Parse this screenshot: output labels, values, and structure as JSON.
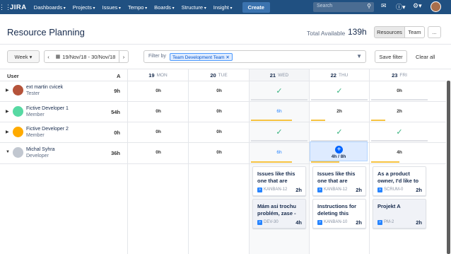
{
  "nav": {
    "logo": "JIRA",
    "menus": [
      "Dashboards",
      "Projects",
      "Issues",
      "Tempo",
      "Boards",
      "Structure",
      "Insight"
    ],
    "create": "Create",
    "search_placeholder": "Search"
  },
  "header": {
    "title": "Resource Planning",
    "total_label": "Total Available",
    "total_value": "139h",
    "view_buttons": [
      "Resources",
      "Team",
      "..."
    ]
  },
  "toolbar": {
    "period": "Week",
    "date_range": "19/Nov/18 - 30/Nov/18",
    "filter_label": "Filter by",
    "filter_tag": "Team Development Team",
    "save_filter": "Save filter",
    "clear_all": "Clear all"
  },
  "grid": {
    "user_header": "User",
    "a_header": "A",
    "days": [
      {
        "num": "19",
        "name": "MON"
      },
      {
        "num": "20",
        "name": "TUE"
      },
      {
        "num": "21",
        "name": "WED"
      },
      {
        "num": "22",
        "name": "THU"
      },
      {
        "num": "23",
        "name": "FRI"
      }
    ],
    "users": [
      {
        "name": "ext martin cvicek",
        "role": "Tester",
        "hours": "9h",
        "cells": [
          "0h",
          "0h",
          "check",
          "check",
          "0h"
        ]
      },
      {
        "name": "Fictive Developer 1",
        "role": "Member",
        "hours": "54h",
        "cells": [
          "0h",
          "0h",
          "6h",
          "2h",
          "2h"
        ]
      },
      {
        "name": "Fictive Developer 2",
        "role": "Member",
        "hours": "0h",
        "cells": [
          "0h",
          "0h",
          "check",
          "check",
          "check"
        ]
      },
      {
        "name": "Michal Syhra",
        "role": "Developer",
        "hours": "36h",
        "cells": [
          "0h",
          "0h",
          "6h",
          "4h / 8h",
          "4h"
        ]
      }
    ]
  },
  "cards": [
    {
      "title": "Issues like this one that are",
      "key": "KANBAN-12",
      "hours": "2h"
    },
    {
      "title": "Issues like this one that are",
      "key": "KANBAN-12",
      "hours": "2h"
    },
    {
      "title": "As a product owner, I'd like to",
      "key": "SCRUM-0",
      "hours": "2h"
    },
    {
      "title": "Mám asi trochu problém, zase -",
      "key": "DEV-30",
      "hours": "4h"
    },
    {
      "title": "Instructions for deleting this",
      "key": "KANBAN-10",
      "hours": "2h"
    },
    {
      "title": "Projekt A",
      "key": "PM-2",
      "hours": "2h"
    }
  ]
}
